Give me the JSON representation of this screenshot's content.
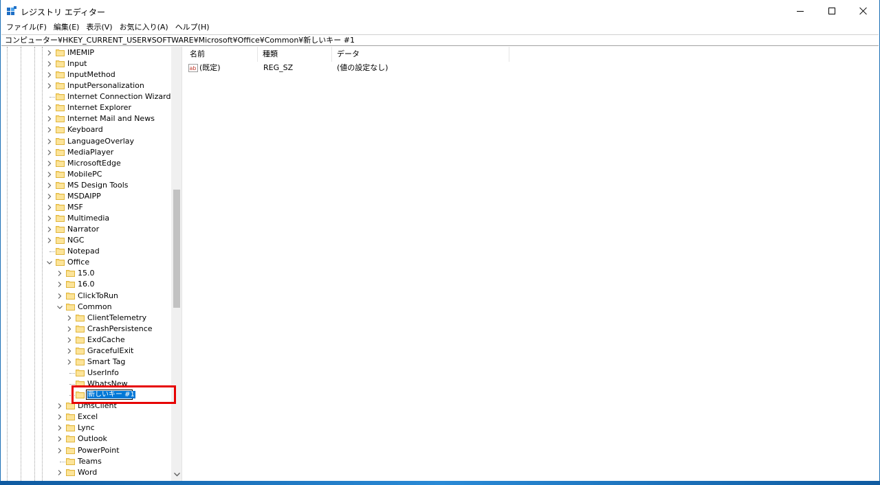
{
  "window": {
    "title": "レジストリ エディター",
    "accent_color": "#0078d7",
    "highlight_color": "#e60000"
  },
  "menubar": [
    "ファイル(F)",
    "編集(E)",
    "表示(V)",
    "お気に入り(A)",
    "ヘルプ(H)"
  ],
  "address": "コンピューター¥HKEY_CURRENT_USER¥SOFTWARE¥Microsoft¥Office¥Common¥新しいキー #1",
  "tree": [
    {
      "label": "IMEMIP",
      "level": 0,
      "expander": "collapsed"
    },
    {
      "label": "Input",
      "level": 0,
      "expander": "collapsed"
    },
    {
      "label": "InputMethod",
      "level": 0,
      "expander": "collapsed"
    },
    {
      "label": "InputPersonalization",
      "level": 0,
      "expander": "collapsed"
    },
    {
      "label": "Internet Connection Wizard",
      "level": 0,
      "expander": "none"
    },
    {
      "label": "Internet Explorer",
      "level": 0,
      "expander": "collapsed"
    },
    {
      "label": "Internet Mail and News",
      "level": 0,
      "expander": "collapsed"
    },
    {
      "label": "Keyboard",
      "level": 0,
      "expander": "collapsed"
    },
    {
      "label": "LanguageOverlay",
      "level": 0,
      "expander": "collapsed"
    },
    {
      "label": "MediaPlayer",
      "level": 0,
      "expander": "collapsed"
    },
    {
      "label": "MicrosoftEdge",
      "level": 0,
      "expander": "collapsed"
    },
    {
      "label": "MobilePC",
      "level": 0,
      "expander": "collapsed"
    },
    {
      "label": "MS Design Tools",
      "level": 0,
      "expander": "collapsed"
    },
    {
      "label": "MSDAIPP",
      "level": 0,
      "expander": "collapsed"
    },
    {
      "label": "MSF",
      "level": 0,
      "expander": "collapsed"
    },
    {
      "label": "Multimedia",
      "level": 0,
      "expander": "collapsed"
    },
    {
      "label": "Narrator",
      "level": 0,
      "expander": "collapsed"
    },
    {
      "label": "NGC",
      "level": 0,
      "expander": "collapsed"
    },
    {
      "label": "Notepad",
      "level": 0,
      "expander": "none"
    },
    {
      "label": "Office",
      "level": 0,
      "expander": "expanded"
    },
    {
      "label": "15.0",
      "level": 1,
      "expander": "collapsed"
    },
    {
      "label": "16.0",
      "level": 1,
      "expander": "collapsed"
    },
    {
      "label": "ClickToRun",
      "level": 1,
      "expander": "collapsed"
    },
    {
      "label": "Common",
      "level": 1,
      "expander": "expanded"
    },
    {
      "label": "ClientTelemetry",
      "level": 2,
      "expander": "collapsed"
    },
    {
      "label": "CrashPersistence",
      "level": 2,
      "expander": "collapsed"
    },
    {
      "label": "ExdCache",
      "level": 2,
      "expander": "collapsed"
    },
    {
      "label": "GracefulExit",
      "level": 2,
      "expander": "collapsed"
    },
    {
      "label": "Smart Tag",
      "level": 2,
      "expander": "collapsed"
    },
    {
      "label": "UserInfo",
      "level": 2,
      "expander": "none"
    },
    {
      "label": "WhatsNew",
      "level": 2,
      "expander": "none"
    },
    {
      "label": "",
      "level": 2,
      "expander": "none",
      "renaming": true
    },
    {
      "label": "DmsClient",
      "level": 1,
      "expander": "collapsed"
    },
    {
      "label": "Excel",
      "level": 1,
      "expander": "collapsed"
    },
    {
      "label": "Lync",
      "level": 1,
      "expander": "collapsed"
    },
    {
      "label": "Outlook",
      "level": 1,
      "expander": "collapsed"
    },
    {
      "label": "PowerPoint",
      "level": 1,
      "expander": "collapsed"
    },
    {
      "label": "Teams",
      "level": 1,
      "expander": "none"
    },
    {
      "label": "Word",
      "level": 1,
      "expander": "collapsed"
    }
  ],
  "rename_value": "新しいキー #1",
  "list": {
    "columns": [
      "名前",
      "種類",
      "データ"
    ],
    "rows": [
      {
        "name": "(既定)",
        "type": "REG_SZ",
        "data": "(値の設定なし)",
        "icon": "reg-sz-icon"
      }
    ]
  }
}
